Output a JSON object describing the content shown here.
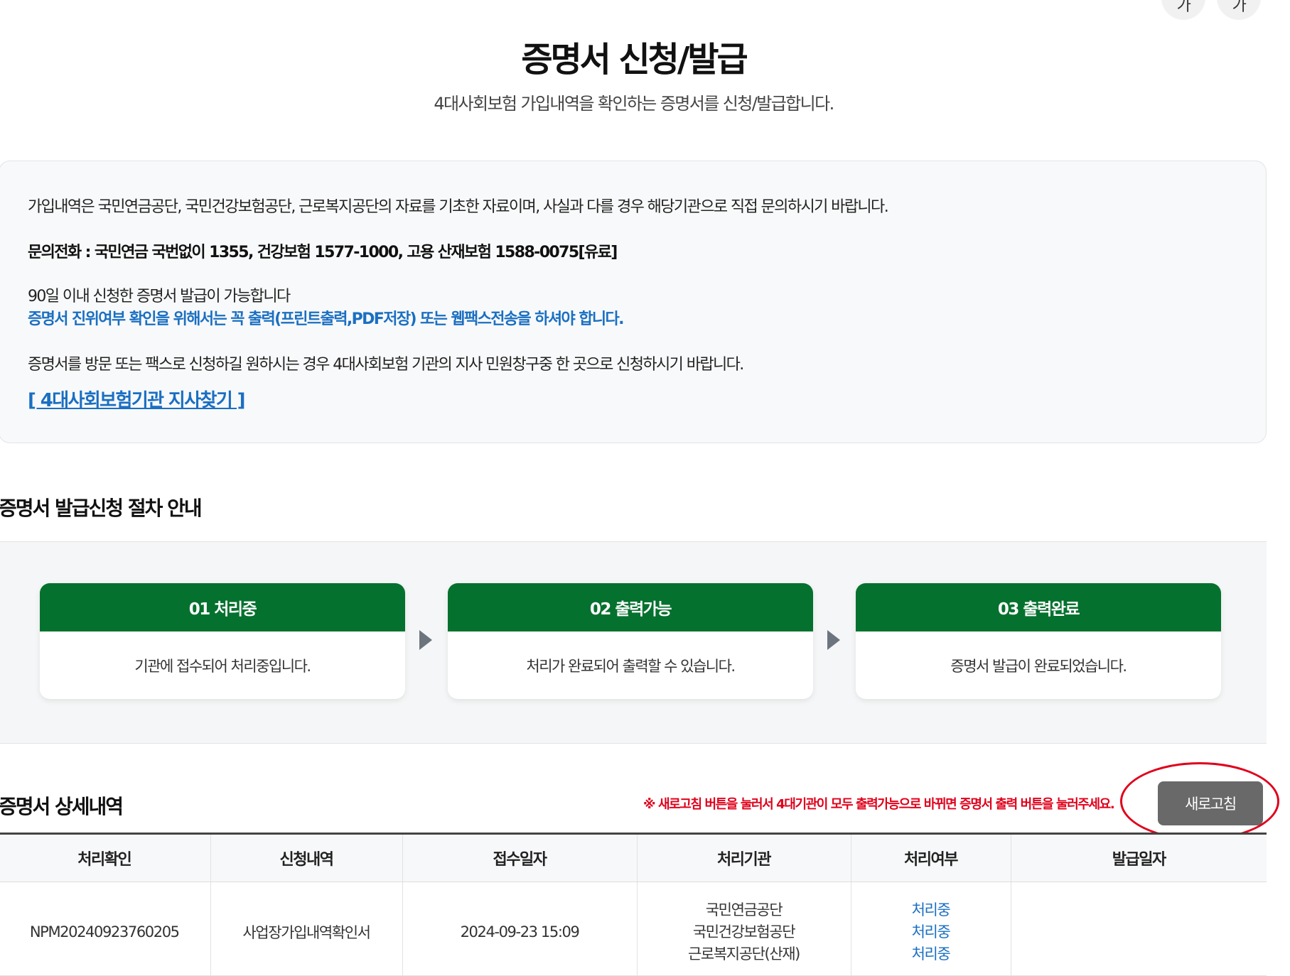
{
  "corner_buttons": [
    "가",
    "가"
  ],
  "page": {
    "title": "증명서 신청/발급",
    "subtitle": "4대사회보험 가입내역을 확인하는 증명서를 신청/발급합니다."
  },
  "info": {
    "line1": "가입내역은 국민연금공단, 국민건강보험공단, 근로복지공단의 자료를 기초한 자료이며, 사실과 다를 경우 해당기관으로 직접 문의하시기 바랍니다.",
    "phone": "문의전화 : 국민연금 국번없이 1355, 건강보험 1577-1000, 고용 산재보험 1588-0075[유료]",
    "line3": "90일 이내 신청한 증명서 발급이 가능합니다",
    "notice_blue": "증명서 진위여부 확인을 위해서는 꼭 출력(프린트출력,PDF저장) 또는 웹팩스전송을 하셔야 합니다.",
    "line5": "증명서를 방문 또는 팩스로 신청하길 원하시는 경우 4대사회보험 기관의 지사 민원창구중 한 곳으로 신청하시기 바랍니다.",
    "branch_link": "[ 4대사회보험기관 지사찾기 ]"
  },
  "steps_section": {
    "title": "증명서 발급신청 절차 안내",
    "steps": [
      {
        "head": "01 처리중",
        "desc": "기관에 접수되어 처리중입니다."
      },
      {
        "head": "02 출력가능",
        "desc": "처리가 완료되어 출력할 수 있습니다."
      },
      {
        "head": "03 출력완료",
        "desc": "증명서 발급이 완료되었습니다."
      }
    ]
  },
  "detail_section": {
    "title": "증명서 상세내역",
    "notice": "※ 새로고침 버튼을 눌러서 4대기관이 모두 출력가능으로 바뀌면 증명서 출력 버튼을 눌러주세요.",
    "refresh_label": "새로고침",
    "columns": [
      "처리확인",
      "신청내역",
      "접수일자",
      "처리기관",
      "처리여부",
      "발급일자"
    ],
    "rows": [
      {
        "id": "NPM20240923760205",
        "request": "사업장가입내역확인서",
        "received": "2024-09-23 15:09",
        "agencies": [
          "국민연금공단",
          "국민건강보험공단",
          "근로복지공단(산재)"
        ],
        "statuses": [
          "처리중",
          "처리중",
          "처리중"
        ],
        "issued": ""
      }
    ]
  },
  "colors": {
    "step_header_green": "#05712e",
    "link_blue": "#1a6fc2",
    "notice_red": "#e0001b",
    "refresh_button_gray": "#696969"
  }
}
